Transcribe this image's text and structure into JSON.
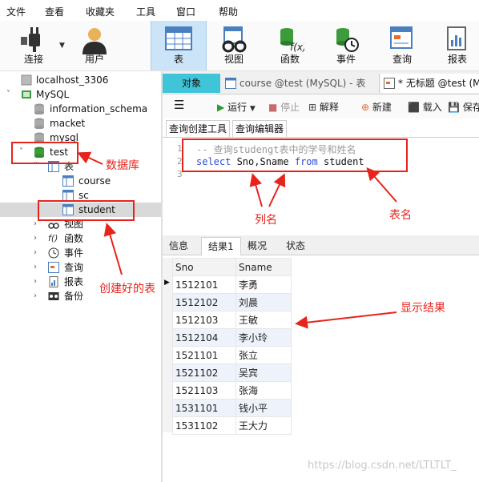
{
  "menubar": [
    "文件",
    "查看",
    "收藏夹",
    "工具",
    "窗口",
    "帮助"
  ],
  "toolbar": {
    "items": [
      "连接",
      "用户",
      "表",
      "视图",
      "函数",
      "事件",
      "查询",
      "报表"
    ],
    "active": "表"
  },
  "tree": {
    "connection": "localhost_3306",
    "server": "MySQL",
    "databases": [
      "information_schema",
      "macket",
      "mysql",
      "test"
    ],
    "tables_folder": "表",
    "tables": [
      "course",
      "sc",
      "student"
    ],
    "folders": [
      "视图",
      "函数",
      "事件",
      "查询",
      "报表",
      "备份"
    ]
  },
  "tabs": {
    "objects": "对象",
    "tab1": "course @test (MySQL) - 表",
    "tab2": "* 无标题 @test (M"
  },
  "query_toolbar": {
    "run": "运行",
    "stop": "停止",
    "explain": "解释",
    "new": "新建",
    "load": "载入",
    "save": "保存"
  },
  "subtabs": [
    "查询创建工具",
    "查询编辑器"
  ],
  "editor": {
    "line_numbers": [
      "1",
      "2",
      "3"
    ],
    "comment": "-- 查询studengt表中的学号和姓名",
    "kw_select": "select",
    "cols": " Sno,Sname ",
    "kw_from": "from",
    "table": " student"
  },
  "result_tabs": [
    "信息",
    "结果1",
    "概况",
    "状态"
  ],
  "grid": {
    "columns": [
      "Sno",
      "Sname"
    ],
    "rows": [
      [
        "1512101",
        "李勇"
      ],
      [
        "1512102",
        "刘晨"
      ],
      [
        "1512103",
        "王敏"
      ],
      [
        "1512104",
        "李小玲"
      ],
      [
        "1521101",
        "张立"
      ],
      [
        "1521102",
        "吴宾"
      ],
      [
        "1521103",
        "张海"
      ],
      [
        "1531101",
        "钱小平"
      ],
      [
        "1531102",
        "王大力"
      ]
    ]
  },
  "annotations": {
    "database": "数据库",
    "created_table": "创建好的表",
    "column_name": "列名",
    "table_name": "表名",
    "result": "显示结果"
  },
  "watermark": "https://blog.csdn.net/LTLTLT_",
  "colors": {
    "annotation": "#e8231c",
    "db_green": "#3c9c3c",
    "active_toolbar": "#cce4f7"
  }
}
